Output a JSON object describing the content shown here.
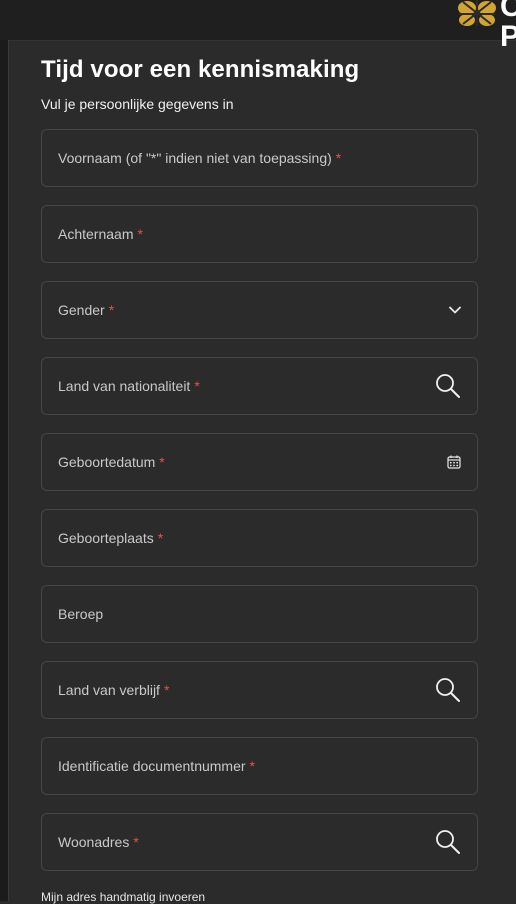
{
  "brand": {
    "text_line1": "C",
    "text_line2": "P",
    "logo_color": "#d2a432"
  },
  "form": {
    "title": "Tijd voor een kennismaking",
    "subtitle": "Vul je persoonlijke gegevens in",
    "required_marker": "*",
    "fields": [
      {
        "label": "Voornaam (of \"*\" indien niet van toepassing)",
        "required": true,
        "icon": ""
      },
      {
        "label": "Achternaam",
        "required": true,
        "icon": ""
      },
      {
        "label": "Gender",
        "required": true,
        "icon": "chevron-down-icon"
      },
      {
        "label": "Land van nationaliteit",
        "required": true,
        "icon": "search-icon"
      },
      {
        "label": "Geboortedatum",
        "required": true,
        "icon": "calendar-icon"
      },
      {
        "label": "Geboorteplaats",
        "required": true,
        "icon": ""
      },
      {
        "label": "Beroep",
        "required": false,
        "icon": ""
      },
      {
        "label": "Land van verblijf",
        "required": true,
        "icon": "search-icon"
      },
      {
        "label": "Identificatie documentnummer",
        "required": true,
        "icon": ""
      },
      {
        "label": "Woonadres",
        "required": true,
        "icon": "search-icon"
      }
    ],
    "manual_address_link": "Mijn adres handmatig invoeren"
  },
  "colors": {
    "background": "#2b2b2b",
    "border": "#454545",
    "required": "#e0544c",
    "accent": "#d2a432"
  }
}
